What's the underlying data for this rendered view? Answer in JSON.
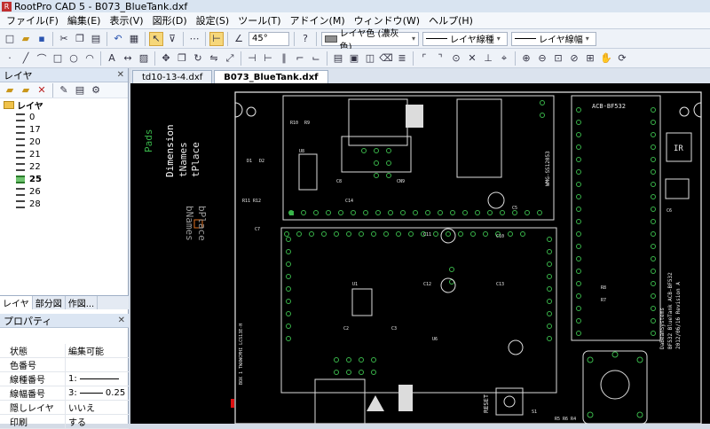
{
  "app": {
    "title": "RootPro CAD 5 - B073_BlueTank.dxf"
  },
  "menu": [
    "ファイル(F)",
    "編集(E)",
    "表示(V)",
    "図形(D)",
    "設定(S)",
    "ツール(T)",
    "アドイン(M)",
    "ウィンドウ(W)",
    "ヘルプ(H)"
  ],
  "toolbar": {
    "angle": "45°",
    "layer_color": "レイヤ色 (濃灰色)",
    "layer_linetype": "レイヤ線種",
    "layer_lineweight": "レイヤ線幅"
  },
  "layers_pane": {
    "title": "レイヤ",
    "root": "レイヤ",
    "items": [
      "0",
      "17",
      "20",
      "21",
      "22",
      "25",
      "26",
      "28"
    ],
    "active": "25"
  },
  "pane_tabs": [
    "レイヤ",
    "部分図",
    "作図..."
  ],
  "properties": {
    "title": "プロパティ",
    "rows": [
      {
        "key": "状態",
        "value": "編集可能"
      },
      {
        "key": "色番号",
        "value": ""
      },
      {
        "key": "線種番号",
        "value": "1:"
      },
      {
        "key": "線幅番号",
        "value": "3:",
        "suffix": "0.25"
      },
      {
        "key": "隠しレイヤ",
        "value": "いいえ"
      },
      {
        "key": "印刷",
        "value": "する"
      }
    ]
  },
  "doc_tabs": [
    "td10-13-4.dxf",
    "B073_BlueTank.dxf"
  ],
  "active_doc": "B073_BlueTank.dxf",
  "drawing": {
    "labels": {
      "pads": "Pads",
      "dimension": "Dimension",
      "tnames": "tNames",
      "place": "tPlace",
      "bnames": "bNames",
      "bplace": "bPlace",
      "module": "ACB-BF532",
      "ir": "IR",
      "reset": "RESET",
      "credit": "DaBeanSystems",
      "credit2": "BF532 BlueTank ACB-BF532",
      "credit3": "2012/06/16 Revision A",
      "conn": "WMG-SS12053",
      "side": "BOX 1 TWXWCMHI LCS13E-H",
      "r10": "R10",
      "r9": "R9",
      "d1": "D1",
      "d2": "D2",
      "u8": "U8",
      "c8": "C8",
      "c14": "C14",
      "cn9": "CN9",
      "c5": "C5",
      "c6": "C6",
      "u1": "U1",
      "c2": "C2",
      "c3": "C3",
      "u6": "U6",
      "c11": "C11",
      "c12": "C12",
      "c10": "C10",
      "c13": "C13",
      "r11": "R11 R12",
      "c7": "C7",
      "r7": "R7",
      "r8": "R8",
      "s1": "S1",
      "r5r6": "R5 R6 R4"
    }
  }
}
